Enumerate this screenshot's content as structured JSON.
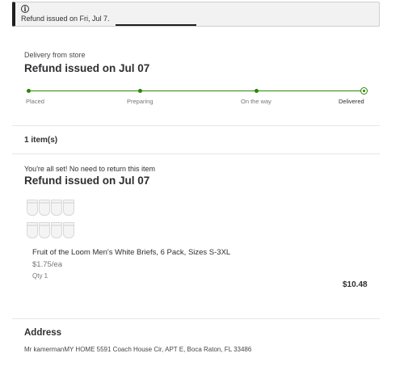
{
  "alert": {
    "icon": "info-icon",
    "icon_glyph": "i",
    "text": "Refund issued on Fri, Jul 7."
  },
  "order": {
    "delivery_type": "Delivery from store",
    "status_title": "Refund issued on Jul 07",
    "tracker": {
      "steps": [
        {
          "label": "Placed",
          "state": "complete"
        },
        {
          "label": "Preparing",
          "state": "complete"
        },
        {
          "label": "On the way",
          "state": "complete"
        },
        {
          "label": "Delivered",
          "state": "current"
        }
      ],
      "color": "#2a8703"
    },
    "items_count": "1 item(s)",
    "return_note": "You're all set! No need to return this item",
    "refund_title": "Refund issued on Jul 07",
    "item": {
      "name": "Fruit of the Loom Men's White Briefs, 6 Pack, Sizes S-3XL",
      "unit_price": "$1.75/ea",
      "qty": "Qty 1",
      "total": "$10.48"
    }
  },
  "address": {
    "title": "Address",
    "text": "Mr kamermanMY HOME 5591 Coach House Cir, APT E, Boca Raton, FL 33486"
  }
}
